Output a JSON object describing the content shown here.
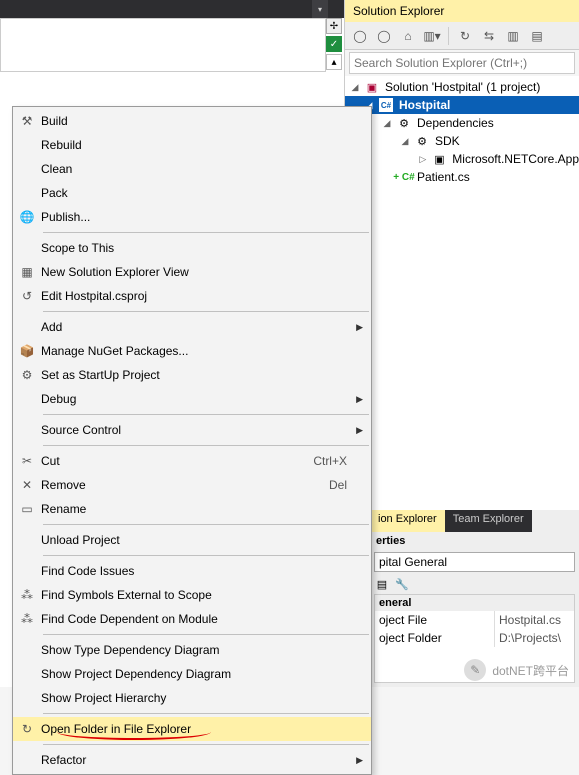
{
  "solutionExplorer": {
    "title": "Solution Explorer",
    "searchPlaceholder": "Search Solution Explorer (Ctrl+;)",
    "tree": {
      "solution": "Solution 'Hostpital' (1 project)",
      "project": "Hostpital",
      "dependencies": "Dependencies",
      "sdk": "SDK",
      "sdkItem": "Microsoft.NETCore.App",
      "fileMarker": "+ C#",
      "file": "Patient.cs"
    },
    "tabs": {
      "active": "ion Explorer",
      "inactive": "Team Explorer"
    }
  },
  "properties": {
    "title": "erties",
    "combo": "pital  General",
    "category": "eneral",
    "rows": [
      {
        "k": "oject File",
        "v": "Hostpital.cs"
      },
      {
        "k": "oject Folder",
        "v": "D:\\Projects\\"
      }
    ]
  },
  "contextMenu": {
    "items": [
      {
        "icon": "build",
        "label": "Build"
      },
      {
        "label": "Rebuild"
      },
      {
        "label": "Clean"
      },
      {
        "label": "Pack"
      },
      {
        "icon": "globe",
        "label": "Publish..."
      },
      {
        "sep": true
      },
      {
        "label": "Scope to This"
      },
      {
        "icon": "newview",
        "label": "New Solution Explorer View"
      },
      {
        "icon": "edit",
        "label": "Edit Hostpital.csproj"
      },
      {
        "sep": true
      },
      {
        "label": "Add",
        "sub": true
      },
      {
        "icon": "nuget",
        "label": "Manage NuGet Packages..."
      },
      {
        "icon": "gear",
        "label": "Set as StartUp Project"
      },
      {
        "label": "Debug",
        "sub": true
      },
      {
        "sep": true
      },
      {
        "label": "Source Control",
        "sub": true
      },
      {
        "sep": true
      },
      {
        "icon": "cut",
        "label": "Cut",
        "shortcut": "Ctrl+X"
      },
      {
        "icon": "remove",
        "label": "Remove",
        "shortcut": "Del"
      },
      {
        "icon": "rename",
        "label": "Rename"
      },
      {
        "sep": true
      },
      {
        "label": "Unload Project"
      },
      {
        "sep": true
      },
      {
        "label": "Find Code Issues"
      },
      {
        "icon": "symbols",
        "label": "Find Symbols External to Scope"
      },
      {
        "icon": "depend",
        "label": "Find Code Dependent on Module"
      },
      {
        "sep": true
      },
      {
        "label": "Show Type Dependency Diagram"
      },
      {
        "label": "Show Project Dependency Diagram"
      },
      {
        "label": "Show Project Hierarchy"
      },
      {
        "sep": true
      },
      {
        "icon": "folder",
        "label": "Open Folder in File Explorer",
        "highlight": true,
        "redline": true
      },
      {
        "sep": true
      },
      {
        "label": "Refactor",
        "sub": true
      }
    ]
  },
  "watermark": "dotNET跨平台"
}
